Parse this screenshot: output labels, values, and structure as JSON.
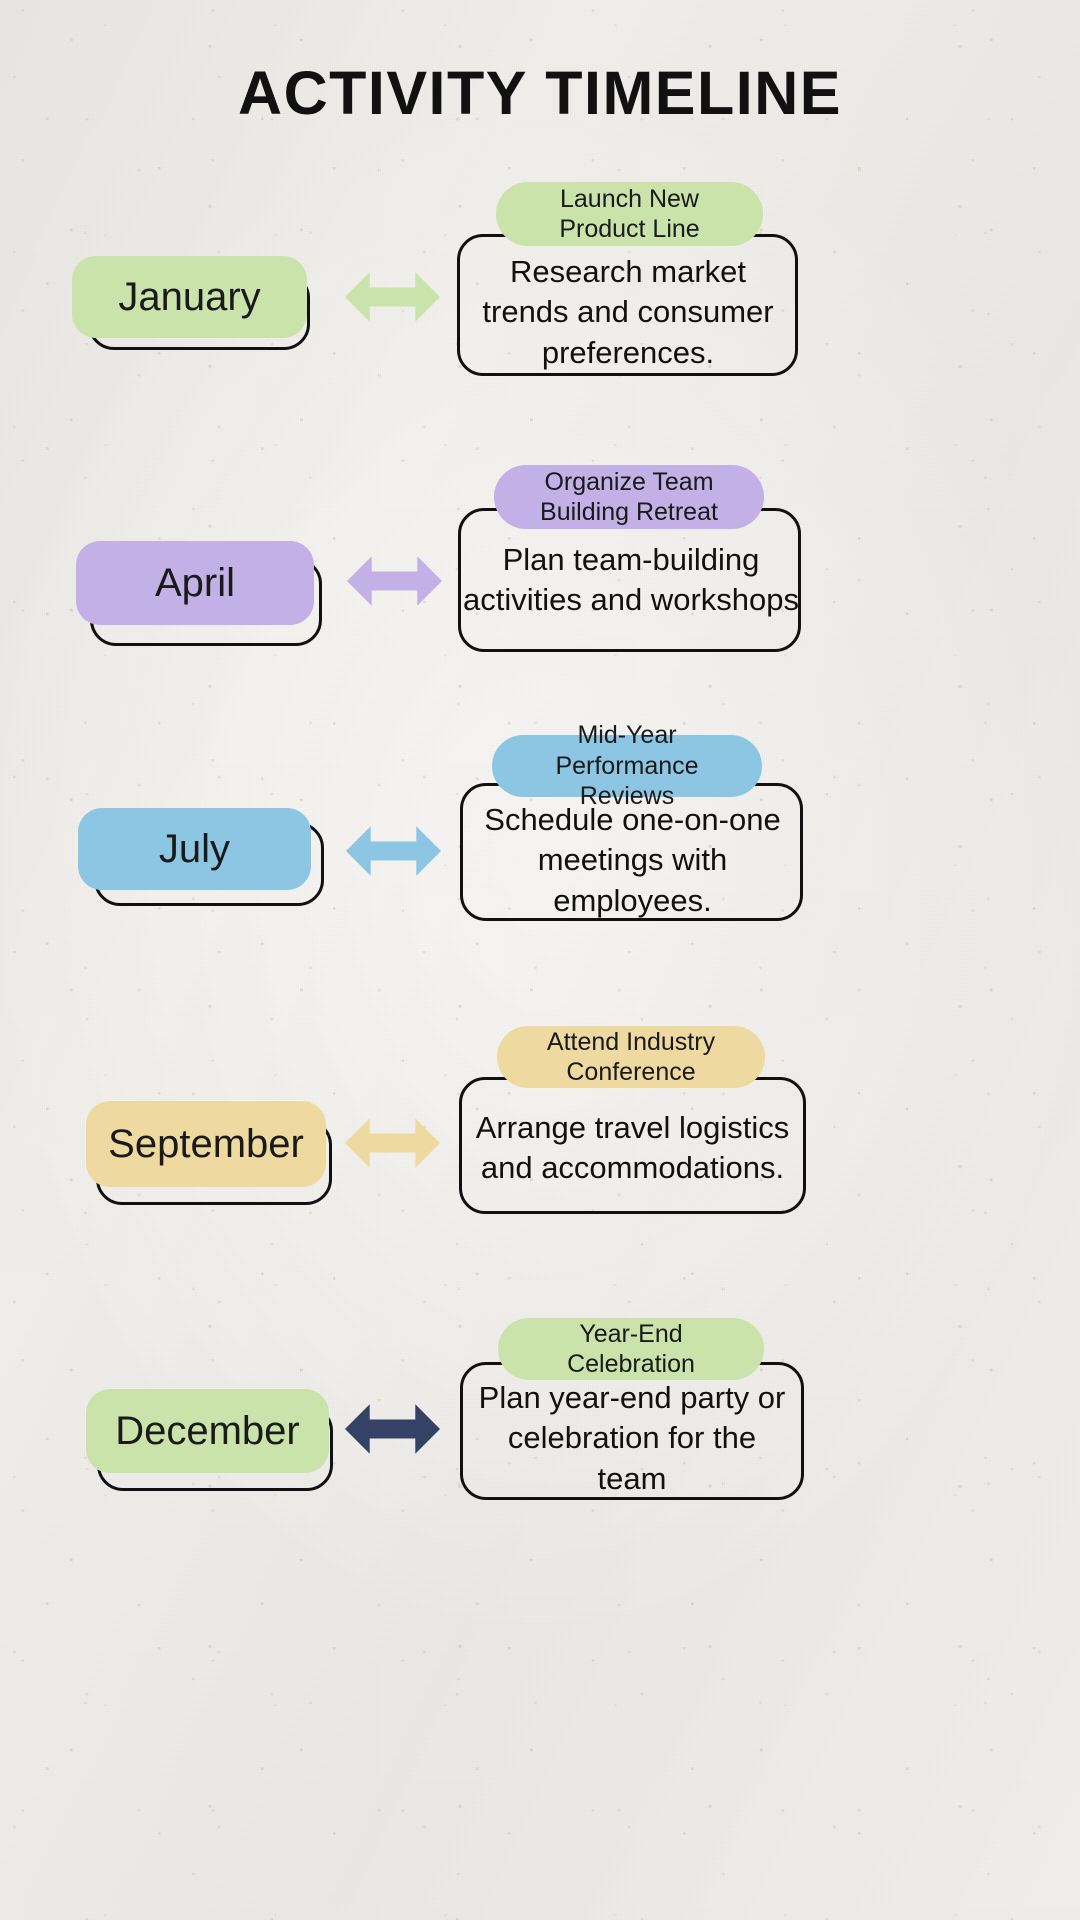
{
  "page": {
    "title": "ACTIVITY TIMELINE",
    "background_color": "#f1efeb",
    "outline_color": "#111111",
    "text_color": "#1a1a1a"
  },
  "rows": [
    {
      "month": "January",
      "color": "#c9e3ab",
      "arrow_color": "#c9e3ab",
      "arrow_name": "double-arrow-january",
      "task_title": "Launch New\nProduct Line",
      "task_title_line1": "Launch New",
      "task_title_line2": "Product Line",
      "task_desc": "Research market trends and consumer preferences.",
      "task_desc_line1": "Research market",
      "task_desc_line2": "trends and consumer",
      "task_desc_line3": "preferences."
    },
    {
      "month": "April",
      "color": "#c3b0e6",
      "arrow_color": "#c3b0e6",
      "arrow_name": "double-arrow-april",
      "task_title": "Organize Team\nBuilding Retreat",
      "task_title_line1": "Organize Team",
      "task_title_line2": "Building Retreat",
      "task_desc": "Plan team-building activities and workshops",
      "task_desc_line1": "Plan team-building",
      "task_desc_line2": "activities and workshops",
      "task_desc_line3": ""
    },
    {
      "month": "July",
      "color": "#8dc6e3",
      "arrow_color": "#8dc6e3",
      "arrow_name": "double-arrow-july",
      "task_title": "Mid-Year Performance\nReviews",
      "task_title_line1": "Mid-Year Performance",
      "task_title_line2": "Reviews",
      "task_desc": "Schedule one-on-one meetings with employees.",
      "task_desc_line1": "Schedule one-on-one",
      "task_desc_line2": "meetings with",
      "task_desc_line3": "employees."
    },
    {
      "month": "September",
      "color": "#eed9a0",
      "arrow_color": "#eed9a0",
      "arrow_name": "double-arrow-september",
      "task_title": "Attend Industry\nConference",
      "task_title_line1": "Attend Industry",
      "task_title_line2": "Conference",
      "task_desc": "Arrange travel logistics and accommodations.",
      "task_desc_line1": "Arrange travel logistics",
      "task_desc_line2": "and accommodations.",
      "task_desc_line3": ""
    },
    {
      "month": "December",
      "color": "#c9e3ab",
      "arrow_color": "#344265",
      "arrow_name": "double-arrow-december",
      "task_title": "Year-End\nCelebration",
      "task_title_line1": "Year-End",
      "task_title_line2": "Celebration",
      "task_desc": "Plan year-end party or celebration for the team",
      "task_desc_line1": "Plan year-end party or",
      "task_desc_line2": "celebration for the",
      "task_desc_line3": "team"
    }
  ]
}
